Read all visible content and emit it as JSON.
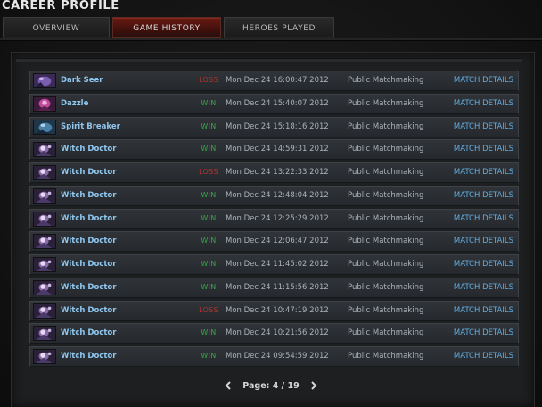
{
  "page_title": "CAREER PROFILE",
  "tabs": [
    {
      "label": "OVERVIEW",
      "active": false
    },
    {
      "label": "GAME HISTORY",
      "active": true
    },
    {
      "label": "HEROES PLAYED",
      "active": false
    }
  ],
  "colors": {
    "win": "#37a64a",
    "loss": "#b33428",
    "hero_name": "#8fc6ee",
    "link": "#63aee3",
    "active_tab": "#6a1a12"
  },
  "matches": [
    {
      "hero": "Dark Seer",
      "icon": "dark-seer-portrait-icon",
      "result": "LOSS",
      "date": "Mon Dec 24 16:00:47 2012",
      "mode": "Public Matchmaking",
      "link": "MATCH DETAILS"
    },
    {
      "hero": "Dazzle",
      "icon": "dazzle-portrait-icon",
      "result": "WIN",
      "date": "Mon Dec 24 15:40:07 2012",
      "mode": "Public Matchmaking",
      "link": "MATCH DETAILS"
    },
    {
      "hero": "Spirit Breaker",
      "icon": "spirit-breaker-portrait-icon",
      "result": "WIN",
      "date": "Mon Dec 24 15:18:16 2012",
      "mode": "Public Matchmaking",
      "link": "MATCH DETAILS"
    },
    {
      "hero": "Witch Doctor",
      "icon": "witch-doctor-portrait-icon",
      "result": "WIN",
      "date": "Mon Dec 24 14:59:31 2012",
      "mode": "Public Matchmaking",
      "link": "MATCH DETAILS"
    },
    {
      "hero": "Witch Doctor",
      "icon": "witch-doctor-portrait-icon",
      "result": "LOSS",
      "date": "Mon Dec 24 13:22:33 2012",
      "mode": "Public Matchmaking",
      "link": "MATCH DETAILS"
    },
    {
      "hero": "Witch Doctor",
      "icon": "witch-doctor-portrait-icon",
      "result": "WIN",
      "date": "Mon Dec 24 12:48:04 2012",
      "mode": "Public Matchmaking",
      "link": "MATCH DETAILS"
    },
    {
      "hero": "Witch Doctor",
      "icon": "witch-doctor-portrait-icon",
      "result": "WIN",
      "date": "Mon Dec 24 12:25:29 2012",
      "mode": "Public Matchmaking",
      "link": "MATCH DETAILS"
    },
    {
      "hero": "Witch Doctor",
      "icon": "witch-doctor-portrait-icon",
      "result": "WIN",
      "date": "Mon Dec 24 12:06:47 2012",
      "mode": "Public Matchmaking",
      "link": "MATCH DETAILS"
    },
    {
      "hero": "Witch Doctor",
      "icon": "witch-doctor-portrait-icon",
      "result": "WIN",
      "date": "Mon Dec 24 11:45:02 2012",
      "mode": "Public Matchmaking",
      "link": "MATCH DETAILS"
    },
    {
      "hero": "Witch Doctor",
      "icon": "witch-doctor-portrait-icon",
      "result": "WIN",
      "date": "Mon Dec 24 11:15:56 2012",
      "mode": "Public Matchmaking",
      "link": "MATCH DETAILS"
    },
    {
      "hero": "Witch Doctor",
      "icon": "witch-doctor-portrait-icon",
      "result": "LOSS",
      "date": "Mon Dec 24 10:47:19 2012",
      "mode": "Public Matchmaking",
      "link": "MATCH DETAILS"
    },
    {
      "hero": "Witch Doctor",
      "icon": "witch-doctor-portrait-icon",
      "result": "WIN",
      "date": "Mon Dec 24 10:21:56 2012",
      "mode": "Public Matchmaking",
      "link": "MATCH DETAILS"
    },
    {
      "hero": "Witch Doctor",
      "icon": "witch-doctor-portrait-icon",
      "result": "WIN",
      "date": "Mon Dec 24 09:54:59 2012",
      "mode": "Public Matchmaking",
      "link": "MATCH DETAILS"
    }
  ],
  "pagination": {
    "label": "Page: 4 / 19",
    "prev_icon": "chevron-left-icon",
    "next_icon": "chevron-right-icon"
  }
}
